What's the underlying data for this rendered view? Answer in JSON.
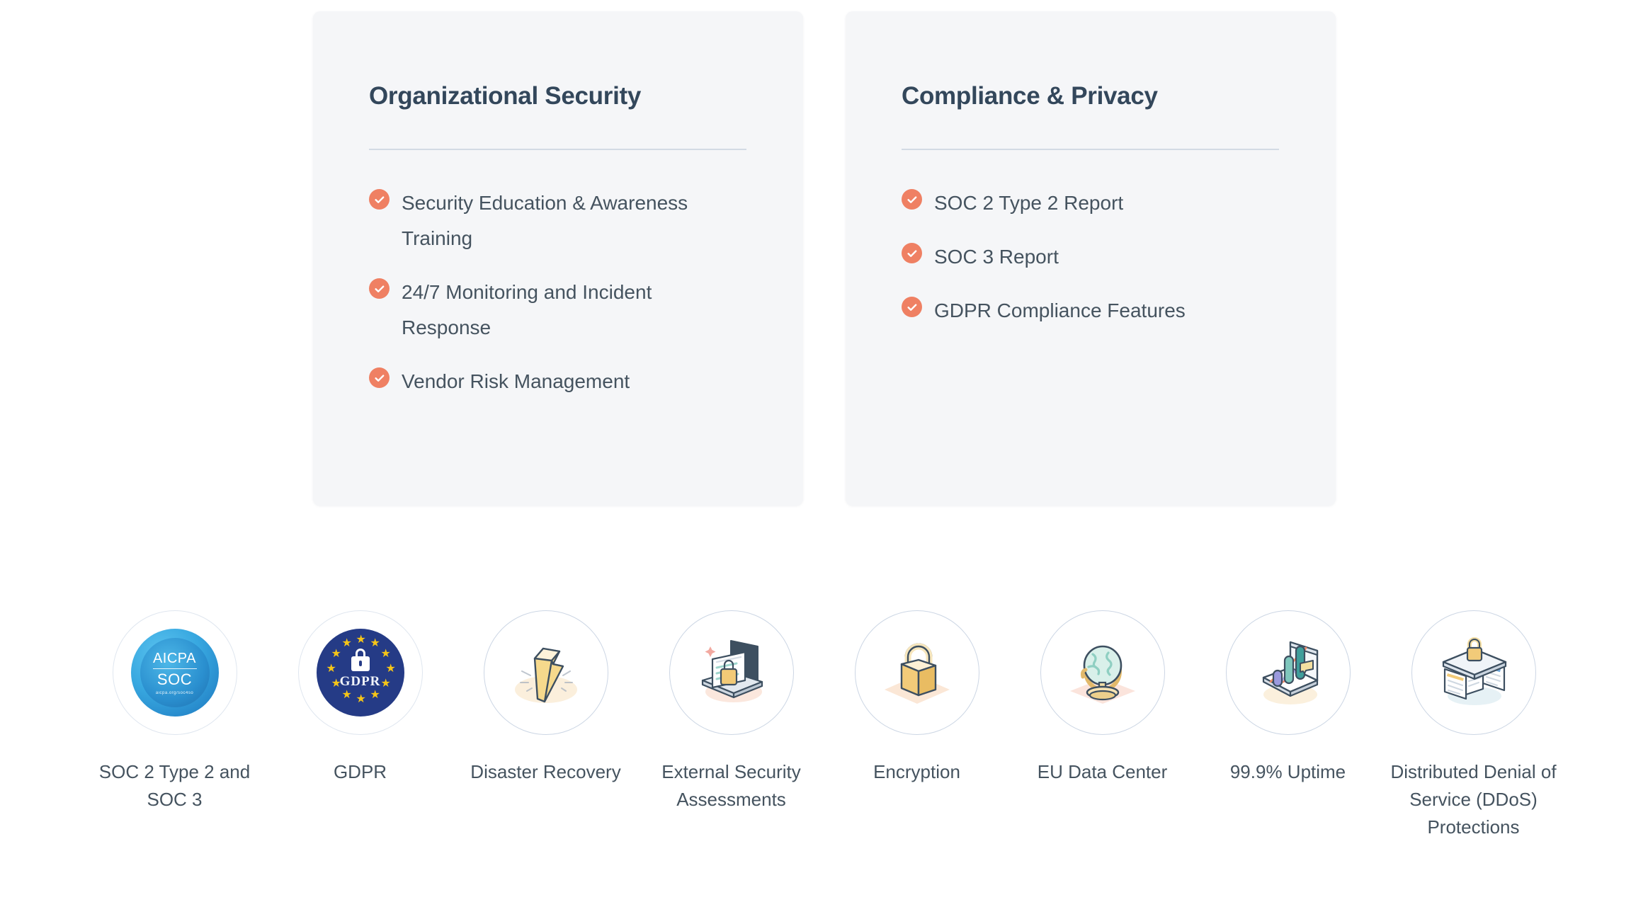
{
  "colors": {
    "card_bg": "#f5f6f8",
    "heading": "#33475b",
    "body_text": "#45535f",
    "check_accent": "#ef8063",
    "divider": "#d3dae4",
    "badge_border": "#ccd6e4",
    "page_bg": "#ffffff"
  },
  "cards": [
    {
      "title": "Organizational Security",
      "items": [
        "Security Education & Awareness Training",
        "24/7 Monitoring and Incident Response",
        "Vendor Risk Management"
      ]
    },
    {
      "title": "Compliance & Privacy",
      "items": [
        "SOC 2 Type 2 Report",
        "SOC 3 Report",
        "GDPR Compliance Features"
      ]
    }
  ],
  "badges": [
    {
      "label": "SOC 2 Type 2 and SOC 3",
      "icon": "aicpa-soc-seal-icon",
      "seal_text": {
        "line1": "AICPA",
        "line2": "SOC",
        "line3": "aicpa.org/soc4so"
      }
    },
    {
      "label": "GDPR",
      "icon": "gdpr-seal-icon",
      "seal_text": {
        "line1": "GDPR"
      }
    },
    {
      "label": "Disaster Recovery",
      "icon": "lightning-bolt-icon"
    },
    {
      "label": "External Security Assessments",
      "icon": "laptop-document-lock-icon"
    },
    {
      "label": "Encryption",
      "icon": "padlock-icon"
    },
    {
      "label": "EU Data Center",
      "icon": "globe-icon"
    },
    {
      "label": "99.9% Uptime",
      "icon": "laptop-bar-chart-icon"
    },
    {
      "label": "Distributed Denial of Service (DDoS) Protections",
      "icon": "secure-documents-table-icon"
    }
  ]
}
